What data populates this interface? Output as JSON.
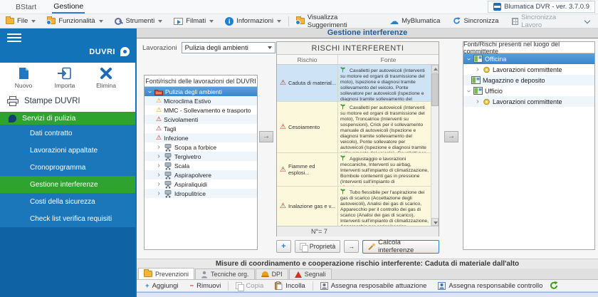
{
  "colors": {
    "sidebar_blue": "#1273b9",
    "sidebar_dark": "#0f62a4",
    "accent_green": "#2fa32f",
    "selection_blue": "#3a86cc",
    "row_selected": "#cfe3f6",
    "row_source_yellow": "#fbf8dc",
    "title_blue": "#1f5c99"
  },
  "titlebar": {
    "tabs": [
      {
        "label": "BStart"
      },
      {
        "label": "Gestione"
      }
    ],
    "version": "Blumatica DVR - ver. 3.7.0.9"
  },
  "menubar": {
    "file": "File",
    "funzionalita": "Funzionalità",
    "strumenti": "Strumenti",
    "filmati": "Filmati",
    "informazioni": "Informazioni",
    "suggerimenti": "Visualizza Suggerimenti",
    "myblumatica": "MyBlumatica",
    "sincronizza": "Sincronizza",
    "sincronizza_lavoro": "Sincronizza Lavoro"
  },
  "sidebar": {
    "title": "DUVRI",
    "actions": [
      {
        "label": "Nuovo",
        "icon": "new-document-icon"
      },
      {
        "label": "Importa",
        "icon": "import-icon"
      },
      {
        "label": "Elimina",
        "icon": "delete-x-icon"
      }
    ],
    "stampe_label": "Stampe DUVRI",
    "service_label": "Servizi di pulizia",
    "menu": [
      {
        "label": "Dati contratto",
        "active": false
      },
      {
        "label": "Lavorazioni appaltate",
        "active": false
      },
      {
        "label": "Cronoprogramma",
        "active": false
      },
      {
        "label": "Gestione interferenze",
        "active": true
      },
      {
        "label": "Costi della sicurezza",
        "active": false
      },
      {
        "label": "Check list verifica requisiti",
        "active": false
      }
    ]
  },
  "main": {
    "page_title": "Gestione interferenze",
    "lavorazioni": {
      "label": "Lavorazioni",
      "value": "Pulizia degli ambienti"
    },
    "left_tree": {
      "header": "Fonti/rischi delle lavorazioni del DUVRI",
      "items": [
        {
          "label": "Pulizia degli ambienti",
          "icon": "folder-red-icon",
          "state": "expanded",
          "selected": true
        },
        {
          "label": "Microclima Estivo",
          "icon": "warning-yellow-icon"
        },
        {
          "label": "MMC - Sollevamento e trasporto",
          "icon": "warning-yellow-icon"
        },
        {
          "label": "Scivolamenti",
          "icon": "warning-red-icon"
        },
        {
          "label": "Tagli",
          "icon": "warning-red-icon"
        },
        {
          "label": "Infezione",
          "icon": "warning-red-icon"
        },
        {
          "label": "Scopa a forbice",
          "icon": "equipment-icon",
          "state": "collapsed"
        },
        {
          "label": "Tergivetro",
          "icon": "equipment-icon",
          "state": "collapsed"
        },
        {
          "label": "Scala",
          "icon": "equipment-icon",
          "state": "collapsed"
        },
        {
          "label": "Aspirapolvere",
          "icon": "equipment-icon",
          "state": "collapsed"
        },
        {
          "label": "Aspiraliquidi",
          "icon": "equipment-icon",
          "state": "collapsed"
        },
        {
          "label": "Idropulitrice",
          "icon": "equipment-icon",
          "state": "collapsed"
        }
      ]
    },
    "risk_table": {
      "title": "RISCHI INTERFERENTI",
      "columns": [
        "Rischio",
        "Fonte"
      ],
      "rows": [
        {
          "selected": true,
          "rischio": "Caduta di material...",
          "fonte": "Cavalletti per autoveicoli (Interventi su motore ed organi di trasmissione del moto), Ispezione e diagnosi tramite sollevamento del veicolo, Ponte sollevatore per autoveicoli (Ispezione e diagnosi tramite sollevamento del veicolo), Cavalletti per autoveicoli (Ispezione e diagnosi tramite sollevamento del veicolo)"
        },
        {
          "selected": false,
          "rischio": "Cesoiamento",
          "fonte": "Cavalletti per autoveicoli (Interventi su motore ed organi di trasmissione del moto), Troncatrice (Interventi su sospensioni), Crick per il sollevamento manuale di autoveicoli (Ispezione e diagnosi tramite sollevamento del veicolo), Ponte sollevatore per autoveicoli (Ispezione e diagnosi tramite sollevamento del veicolo), Cavalletti per autoveicoli (Ispezione e diagnosi tramite sollevamento del veicolo)"
        },
        {
          "selected": false,
          "rischio": "Fiamme ed esplosi...",
          "fonte": "Aggiustaggio e lavorazioni meccaniche, Interventi su airbag, Interventi sull'impianto di climatizzazione, Bombole contenenti gas in pressione (Interventi sull'impianto di climatizzazione)"
        },
        {
          "selected": false,
          "rischio": "Inalazione gas e v...",
          "fonte": "Tubo flessibile per l'aspirazione dei gas di scarico (Accettazione degli autoveicoli), Analisi dei gas di scarico, Apparecchio per il controllo dei gas di scarico (Analisi dei gas di scarico), Interventi sull'impianto di climatizzazione, Apparecchio per carica/scarica dell'impianto di"
        }
      ],
      "count_label": "N°= 7",
      "buttons": {
        "add": "+",
        "properties": "Proprietà",
        "move": "→",
        "calcola": "Calcola interferenze"
      }
    },
    "right_tree": {
      "header": "Fonti/Rischi presenti nel luogo del committente",
      "items": [
        {
          "label": "Officina",
          "icon": "site-icon",
          "state": "expanded",
          "selected": true
        },
        {
          "label": "Lavorazioni committente",
          "icon": "works-icon",
          "state": "collapsed",
          "child": true
        },
        {
          "label": "Magazzino e deposito",
          "icon": "site-icon"
        },
        {
          "label": "Ufficio",
          "icon": "site-icon",
          "state": "expanded"
        },
        {
          "label": "Lavorazioni committente",
          "icon": "works-icon",
          "state": "collapsed",
          "child": true
        }
      ]
    },
    "move_arrow": "→"
  },
  "bottom": {
    "title": "Misure di coordinamento e cooperazione rischio interferente: Caduta di materiale dall'alto",
    "tabs": [
      {
        "label": "Prevenzioni",
        "icon": "folder-yellow-icon",
        "active": true
      },
      {
        "label": "Tecniche org.",
        "icon": "person-icon",
        "active": false
      },
      {
        "label": "DPI",
        "icon": "helmet-icon",
        "active": false
      },
      {
        "label": "Segnali",
        "icon": "signal-icon",
        "active": false
      }
    ],
    "toolbar": {
      "aggiungi": "Aggiungi",
      "rimuovi": "Rimuovi",
      "copia": "Copia",
      "incolla": "Incolla",
      "attuazione": "Assegna resposabile attuazione",
      "controllo": "Assegna responsabile controllo"
    }
  }
}
